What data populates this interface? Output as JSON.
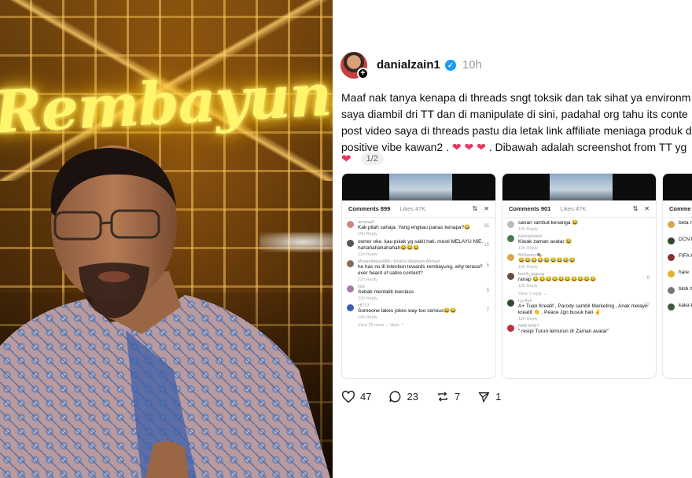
{
  "video": {
    "neon_sign": "Rembayung"
  },
  "post": {
    "username": "danialzain1",
    "time": "10h",
    "lines": [
      "Maaf nak tanya kenapa di threads sngt toksik dan tak sihat ya environm",
      "saya diambil dri TT dan di manipulate di sini, padahal org tahu its conte",
      "post video saya di threads pastu dia letak link affiliate meniaga produk d",
      "positive vibe kawan2 .",
      ". Dibawah adalah screenshot from TT yg",
      "1/2"
    ],
    "hearts": "❤ ❤ ❤",
    "trailing_heart": "❤",
    "pager": "1/2"
  },
  "screenshots": [
    {
      "comments_tab": "Comments 899",
      "likes_tab": "Likes 47K",
      "comments": [
        {
          "user": "amanaA",
          "text": "Kak pilah sahaja. Yang engkau panas kenapa?😂",
          "meta": "19h   Reply",
          "likes": "35"
        },
        {
          "user": "",
          "text": "owner oke. kau pulak yg sakit hati. mesti MELAYU NIE. hahahahahahahah😂😂😂",
          "meta": "21h   Reply",
          "likes": "15"
        },
        {
          "user": "Mozambique888 • Khairul Ridzwan Ahmad",
          "text": "he has no ill intention towards rembayung, why terasa? ever heard of satire content?",
          "meta": "22h   Reply",
          "likes": "6"
        },
        {
          "user": "lola",
          "text": "Sebab mentaliti lowclass",
          "meta": "22h   Reply",
          "likes": "5"
        },
        {
          "user": "zfl727",
          "text": "Someone takes jokes way too serious😂😂",
          "meta": "14h   Reply",
          "likes": "2"
        },
        {
          "user": "",
          "text": "View 76 more ⌄      Hide ⌃",
          "meta": "",
          "likes": ""
        }
      ]
    },
    {
      "comments_tab": "Comments 901",
      "likes_tab": "Likes 47K",
      "comments": [
        {
          "user": "",
          "text": "sanan rambut kenanga 😂",
          "meta": "12h   Reply",
          "likes": ""
        },
        {
          "user": "lukmanwazil",
          "text": "Kiwak zaman avatar 😂",
          "meta": "12h   Reply",
          "likes": ""
        },
        {
          "user": "MrDwano🎭",
          "text": "😂😂😂😂😂😂😂😂😂",
          "meta": "10h   Reply",
          "likes": ""
        },
        {
          "user": "bertih_jagung",
          "text": "ranap 😂😂😂😂😂😂😂😂😂😂",
          "meta": "12h   Reply",
          "likes": "6"
        },
        {
          "user": "",
          "text": "View 1 reply ⌄",
          "meta": "",
          "likes": ""
        },
        {
          "user": "Icy Ash",
          "text": "A+ Tuan Kreatif , Parody sambil Marketing , Anak melayu kreatif 👏 , Peace Jgn busuk hati ✌",
          "meta": "12h   Reply",
          "likes": "12"
        },
        {
          "user": "NAK APE?",
          "text": "\" resipi Turun temurun dr Zaman avatar\"",
          "meta": "",
          "likes": ""
        }
      ]
    },
    {
      "comments_tab": "Comme",
      "likes_tab": "",
      "comments": [
        {
          "user": "",
          "text": "beta mam",
          "meta": "",
          "likes": ""
        },
        {
          "user": "",
          "text": "DCN Pack",
          "meta": "",
          "likes": ""
        },
        {
          "user": "",
          "text": "FIFA Haha",
          "meta": "",
          "likes": ""
        },
        {
          "user": "",
          "text": "hare",
          "meta": "",
          "likes": ""
        },
        {
          "user": "",
          "text": "blob zaman",
          "meta": "",
          "likes": ""
        },
        {
          "user": "",
          "text": "kaka kala",
          "meta": "",
          "likes": ""
        }
      ]
    }
  ],
  "actions": {
    "likes": "47",
    "comments": "23",
    "reposts": "7",
    "shares": "1"
  },
  "colors": {
    "verified": "#1d9bf0",
    "heart": "#e8345d",
    "neon": "#fff56a"
  }
}
